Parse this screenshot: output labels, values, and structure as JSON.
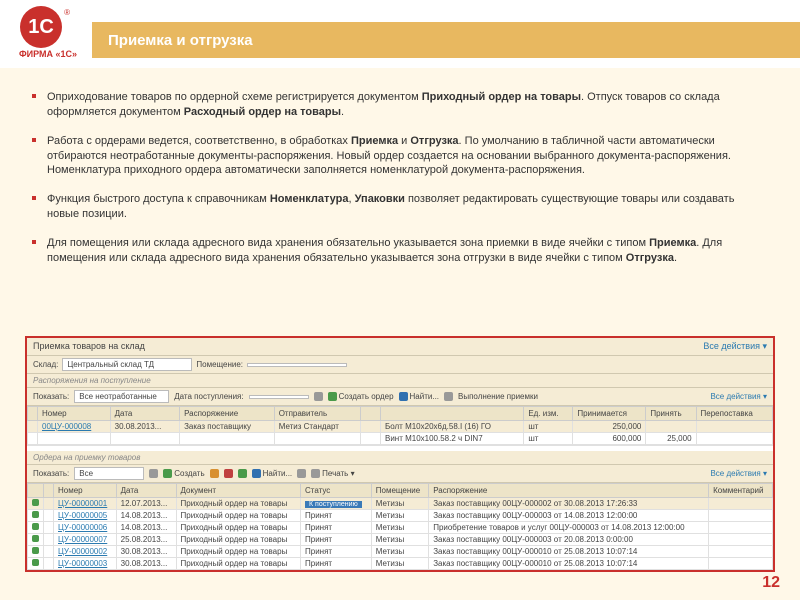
{
  "logo": {
    "mark": "1C",
    "text": "ФИРМА «1С»"
  },
  "title": "Приемка и отгрузка",
  "page_number": "12",
  "bullets": {
    "b1a": "Оприходование товаров по ордерной схеме регистрируется документом ",
    "b1b": "Приходный ордер на товары",
    "b1c": ". Отпуск товаров со склада оформляется документом ",
    "b1d": "Расходный ордер на товары",
    "b1e": ".",
    "b2a": "Работа с ордерами ведется, соответственно, в обработках ",
    "b2b": "Приемка",
    "b2c": " и ",
    "b2d": "Отгрузка",
    "b2e": ". По умолчанию в табличной части автоматически отбираются неотработанные документы-распоряжения. Новый ордер создается на основании выбранного документа-распоряжения. Номенклатура приходного ордера автоматически заполняется номенклатурой документа-распоряжения.",
    "b3a": "Функция быстрого доступа к справочникам ",
    "b3b": "Номенклатура",
    "b3c": ", ",
    "b3d": "Упаковки",
    "b3e": " позволяет редактировать существующие товары или создавать новые позиции.",
    "b4a": "Для помещения или склада адресного вида хранения обязательно указывается зона приемки в виде ячейки с типом ",
    "b4b": "Приемка",
    "b4c": ". Для помещения или склада адресного вида хранения обязательно указывается зона отгрузки в виде ячейки с типом ",
    "b4d": "Отгрузка",
    "b4e": "."
  },
  "app": {
    "title": "Приемка товаров на склад",
    "all_actions": "Все действия ▾",
    "warehouse_label": "Склад:",
    "warehouse_value": "Центральный склад ТД",
    "room_label": "Помещение:",
    "room_value": "",
    "section1": "Распоряжения на поступление",
    "show_label": "Показать:",
    "show_value": "Все неотработанные",
    "date_label": "Дата поступления:",
    "date_value": "",
    "create_order": "Создать ордер",
    "find": "Найти...",
    "do_receipt": "Выполнение приемки",
    "top_cols": [
      "Номер",
      "Дата",
      "Распоряжение",
      "Отправитель",
      "",
      "Ед. изм.",
      "Принимается",
      "Принять",
      "Перепоставка"
    ],
    "top_rows": [
      {
        "num": "00ЦУ-000008",
        "date": "30.08.2013...",
        "doc": "Заказ поставщику",
        "sender": "Метиз Стандарт",
        "item": "Болт М10х20х6д.58.I (16) ГО",
        "unit": "шт",
        "qty1": "250,000",
        "qty2": "",
        "qty3": ""
      },
      {
        "num": "",
        "date": "",
        "doc": "",
        "sender": "",
        "item": "Винт М10х100.58.2 ч DIN7",
        "unit": "шт",
        "qty1": "600,000",
        "qty2": "25,000",
        "qty3": ""
      }
    ],
    "section2": "Ордера на приемку товаров",
    "show2_value": "Все",
    "create": "Создать",
    "print": "Печать ▾",
    "bot_cols": [
      "Номер",
      "Дата",
      "Документ",
      "Статус",
      "Помещение",
      "Распоряжение",
      "Комментарий"
    ],
    "bot_rows": [
      {
        "num": "ЦУ-00000001",
        "date": "12.07.2013...",
        "doc": "Приходный ордер на товары",
        "status": "К поступлению",
        "badge": true,
        "room": "Метизы",
        "order": "Заказ поставщику 00ЦУ-000002 от 30.08.2013 17:26:33"
      },
      {
        "num": "ЦУ-00000005",
        "date": "14.08.2013...",
        "doc": "Приходный ордер на товары",
        "status": "Принят",
        "room": "Метизы",
        "order": "Заказ поставщику 00ЦУ-000003 от 14.08.2013 12:00:00"
      },
      {
        "num": "ЦУ-00000006",
        "date": "14.08.2013...",
        "doc": "Приходный ордер на товары",
        "status": "Принят",
        "room": "Метизы",
        "order": "Приобретение товаров и услуг 00ЦУ-000003 от 14.08.2013 12:00:00"
      },
      {
        "num": "ЦУ-00000007",
        "date": "25.08.2013...",
        "doc": "Приходный ордер на товары",
        "status": "Принят",
        "room": "Метизы",
        "order": "Заказ поставщику 00ЦУ-000003 от 20.08.2013 0:00:00"
      },
      {
        "num": "ЦУ-00000002",
        "date": "30.08.2013...",
        "doc": "Приходный ордер на товары",
        "status": "Принят",
        "room": "Метизы",
        "order": "Заказ поставщику 00ЦУ-000010 от 25.08.2013 10:07:14"
      },
      {
        "num": "ЦУ-00000003",
        "date": "30.08.2013...",
        "doc": "Приходный ордер на товары",
        "status": "Принят",
        "room": "Метизы",
        "order": "Заказ поставщику 00ЦУ-000010 от 25.08.2013 10:07:14"
      }
    ]
  }
}
